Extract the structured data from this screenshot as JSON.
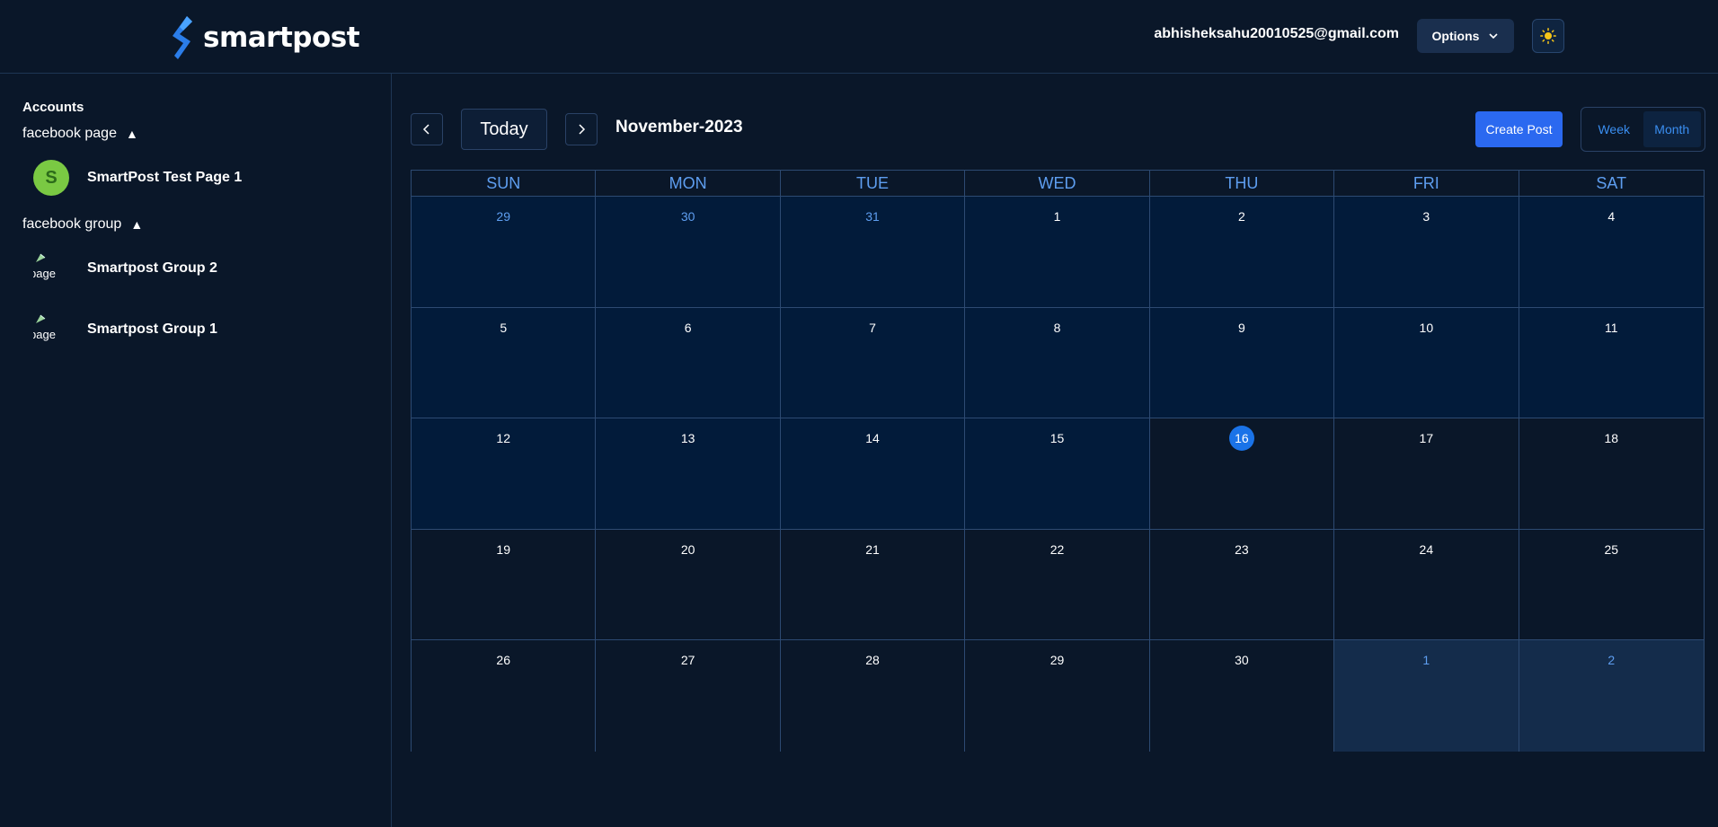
{
  "header": {
    "logo_text": "smartpost",
    "user_email": "abhisheksahu20010525@gmail.com",
    "options_label": "Options",
    "theme_icon": "sun-icon"
  },
  "sidebar": {
    "accounts_title": "Accounts",
    "groups": [
      {
        "label": "facebook page",
        "toggle_icon": "triangle-up-icon",
        "items": [
          {
            "name": "SmartPost Test Page 1",
            "avatar_letter": "S"
          }
        ]
      },
      {
        "label": "facebook group",
        "toggle_icon": "triangle-up-icon",
        "items": [
          {
            "name": "Smartpost Group 2",
            "avatar_alt": "page"
          },
          {
            "name": "Smartpost Group 1",
            "avatar_alt": "page"
          }
        ]
      }
    ]
  },
  "toolbar": {
    "prev_icon": "chevron-left-icon",
    "next_icon": "chevron-right-icon",
    "today_label": "Today",
    "month_title": "November-2023",
    "create_post_label": "Create Post",
    "view_options": [
      "Week",
      "Month"
    ],
    "active_view": "Month"
  },
  "calendar": {
    "weekdays": [
      "SUN",
      "MON",
      "TUE",
      "WED",
      "THU",
      "FRI",
      "SAT"
    ],
    "weeks": [
      [
        "29",
        "30",
        "31",
        "1",
        "2",
        "3",
        "4"
      ],
      [
        "5",
        "6",
        "7",
        "8",
        "9",
        "10",
        "11"
      ],
      [
        "12",
        "13",
        "14",
        "15",
        "16",
        "17",
        "18"
      ],
      [
        "19",
        "20",
        "21",
        "22",
        "23",
        "24",
        "25"
      ],
      [
        "26",
        "27",
        "28",
        "29",
        "30",
        "1",
        "2"
      ]
    ],
    "today": "16"
  },
  "colors": {
    "background": "#0a1729",
    "accent": "#2b69f0",
    "today_circle": "#1a73e8",
    "weekday_text": "#5e9ef0"
  }
}
